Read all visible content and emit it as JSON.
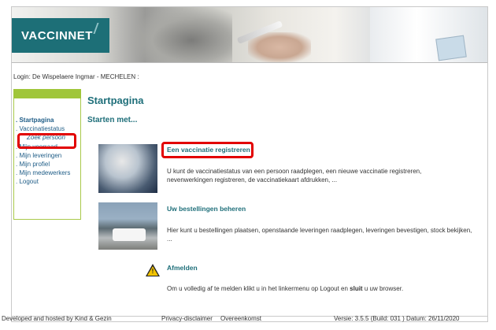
{
  "header": {
    "logo_text": "VACCINNET"
  },
  "login_text": "Login: De Wispelaere Ingmar - MECHELEN :",
  "sidebar": {
    "items": [
      {
        "label": ". Startpagina"
      },
      {
        "label": ". Vaccinatiestatus"
      },
      {
        "label": "Zoek persoon"
      },
      {
        "label": ". Mijn voorraad"
      },
      {
        "label": ". Mijn leveringen"
      },
      {
        "label": ". Mijn profiel"
      },
      {
        "label": ". Mijn medewerkers"
      },
      {
        "label": ". Logout"
      }
    ]
  },
  "main": {
    "title": "Startpagina",
    "subtitle": "Starten met...",
    "sections": [
      {
        "link": "Een vaccinatie registreren",
        "description": "U kunt de vaccinatiestatus van een persoon raadplegen, een nieuwe vaccinatie registreren, nevenwerkingen registreren, de vaccinatiekaart afdrukken, ..."
      },
      {
        "link": "Uw bestellingen beheren",
        "description": "Hier kunt u bestellingen plaatsen, openstaande leveringen raadplegen, leveringen bevestigen, stock bekijken, ..."
      },
      {
        "link": "Afmelden",
        "description_pre": "Om u volledig af te melden klikt u in het linkermenu op Logout en ",
        "description_bold": "sluit",
        "description_post": " u uw browser."
      }
    ],
    "warning_mark": "!"
  },
  "footer": {
    "hosted": "Developed and hosted by Kind & Gezin",
    "privacy": "Privacy-disclaimer",
    "agreement": "Overeenkomst",
    "version": "Versie: 3.5.5 (Build: 031 ) Datum: 26/11/2020"
  },
  "colors": {
    "brand": "#1d6f77",
    "sidebar_accent": "#a0c63a",
    "highlight": "#e20000",
    "link": "#1f6f7a"
  }
}
